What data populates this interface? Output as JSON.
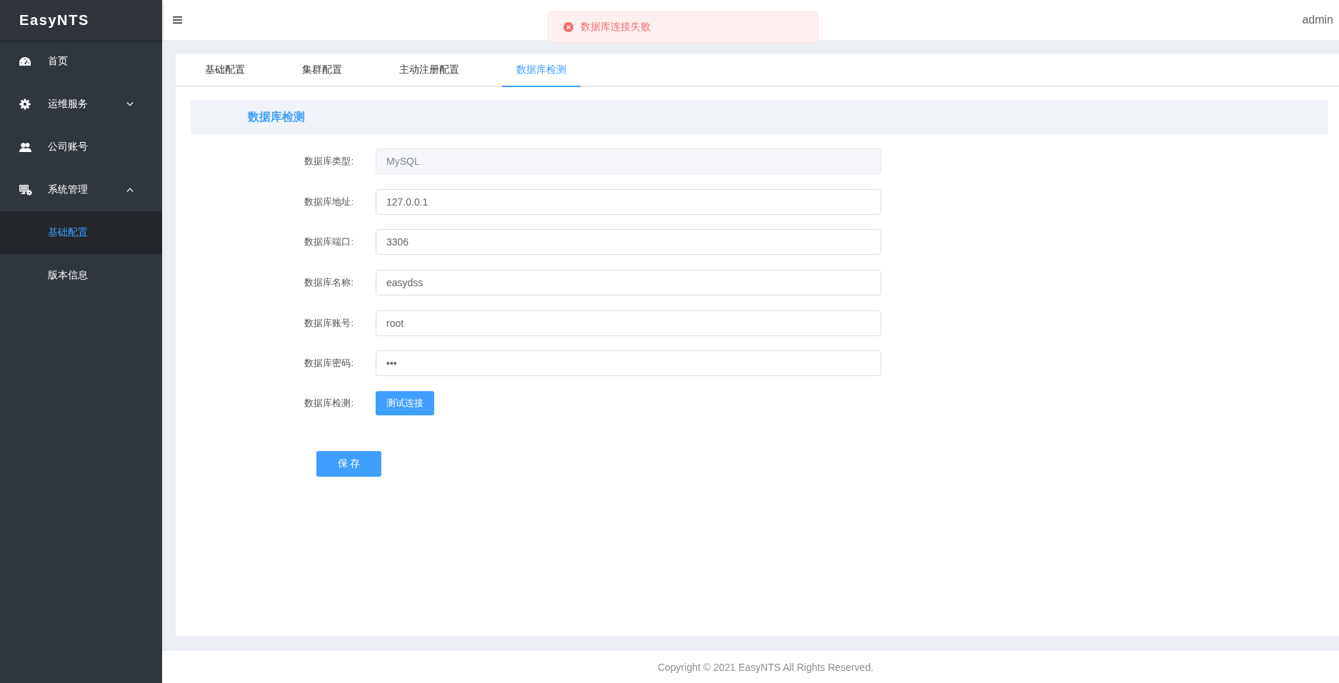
{
  "sidebar": {
    "logo": "EasyNTS",
    "items": [
      {
        "kind": "link",
        "label": "首页",
        "selected": false
      },
      {
        "kind": "group",
        "label": "运维服务",
        "selected": false,
        "expanded": false
      },
      {
        "kind": "link",
        "label": "公司账号",
        "selected": false
      },
      {
        "kind": "group",
        "label": "系统管理",
        "selected": false,
        "expanded": true,
        "children": [
          {
            "label": "基础配置",
            "selected": true
          },
          {
            "label": "版本信息",
            "selected": false
          }
        ]
      }
    ]
  },
  "top_bar": {
    "user": "admin"
  },
  "toast": {
    "kind": "error",
    "message": "数据库连接失败"
  },
  "tabs": [
    {
      "label": "基础配置",
      "selected": false
    },
    {
      "label": "集群配置",
      "selected": false
    },
    {
      "label": "主动注册配置",
      "selected": false
    },
    {
      "label": "数据库检测",
      "selected": true
    }
  ],
  "section": {
    "title": "数据库检测"
  },
  "form": {
    "rows": [
      {
        "kind": "input",
        "label": "数据库类型:",
        "value": "MySQL",
        "disabled": true
      },
      {
        "kind": "input",
        "label": "数据库地址:",
        "value": "127.0.0.1",
        "disabled": false
      },
      {
        "kind": "input",
        "label": "数据库端口:",
        "value": "3306",
        "disabled": false
      },
      {
        "kind": "input",
        "label": "数据库名称:",
        "value": "easydss",
        "disabled": false
      },
      {
        "kind": "input",
        "label": "数据库账号:",
        "value": "root",
        "disabled": false
      },
      {
        "kind": "input",
        "label": "数据库密码:",
        "value": "•••",
        "disabled": false
      },
      {
        "kind": "button",
        "label": "数据库检测:",
        "button": "测试连接",
        "disabled": false
      }
    ],
    "save_button": "保 存"
  },
  "footer": {
    "copyright": "Copyright © 2021 EasyNTS All Rights Reserved."
  }
}
